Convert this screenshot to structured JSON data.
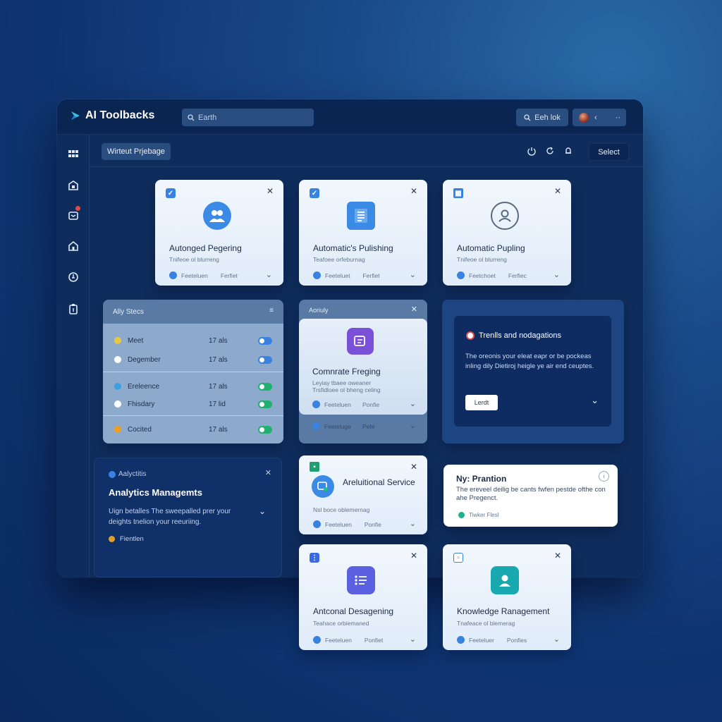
{
  "app": {
    "title": "AI Toolbacks"
  },
  "topbar": {
    "search_placeholder": "Earth",
    "action_label": "Eeh lok",
    "profile_caret": "‹",
    "profile_more": "··"
  },
  "subheader": {
    "page_tab": "Wirteut Prjebage",
    "select_label": "Select"
  },
  "cards": [
    {
      "title": "Autonged Pegering",
      "sub": "Tnifeoe ol blurreng",
      "foot1": "Feeteluen",
      "foot2": "Ferfiet"
    },
    {
      "title": "Automatic's Pulishing",
      "sub": "Teafoee orfeburnag",
      "foot1": "Feeteluet",
      "foot2": "Ferfiet"
    },
    {
      "title": "Automatic Pupling",
      "sub": "Tnifeoe ol blurreng",
      "foot1": "Feetchoet",
      "foot2": "Ferfiec"
    }
  ],
  "agents_panel": {
    "title": "Ally Stecs",
    "rows": [
      {
        "name": "Meet",
        "value": "17 als",
        "color": "#e8c840",
        "toggle": "#3a82e0"
      },
      {
        "name": "Degember",
        "value": "17 als",
        "color": "#ffffff",
        "toggle": "#3a82e0"
      },
      {
        "name": "Ereleence",
        "value": "17 als",
        "color": "#3aa0e0",
        "toggle": "#20b070"
      },
      {
        "name": "Fhisdary",
        "value": "17 lid",
        "color": "#ffffff",
        "toggle": "#20b070"
      },
      {
        "name": "Cocited",
        "value": "17 als",
        "color": "#f0a020",
        "toggle": "#20b070"
      }
    ]
  },
  "activity_card": {
    "header": "Aoriuly",
    "title": "Comnrate Freging",
    "sub1": "Leyiay tbaee oweaner",
    "sub2": "Trsfidloee ol bheng celing",
    "foot1": "Feeteluen",
    "foot2": "Ponfie",
    "foot3": "Feeteluge",
    "foot4": "Pefe"
  },
  "trends": {
    "title": "Trenlls and nodagations",
    "body": "The oreonis your eleat eapr or be pockeas inling dily Dietiroj heigle ye air end ceuptes.",
    "button": "Lerdt"
  },
  "analytics": {
    "header": "Aalyctitis",
    "title": "Analytics Managemts",
    "body": "Uign betalles The sweepalled prer your deights tnelion your reeuriing.",
    "foot": "Fientlen"
  },
  "service_card": {
    "title": "Areluitional Service",
    "sub": "Nsl boce oblemernag",
    "foot1": "Feeteluen",
    "foot2": "Ponfie"
  },
  "notice": {
    "title": "Ny: Prantion",
    "body": "The ereveel deilig be cants fwfen pestde ofthe con ahe Pregenct.",
    "foot": "Tiwker Flesl"
  },
  "bottom_cards": [
    {
      "title": "Antconal Desagening",
      "sub": "Teahace orbiemaned",
      "foot1": "Feeteluen",
      "foot2": "Ponfiet"
    },
    {
      "title": "Knowledge Ranagement",
      "sub": "Tnafeace ol blemerag",
      "foot1": "Feeteluer",
      "foot2": "Ponfies"
    }
  ]
}
